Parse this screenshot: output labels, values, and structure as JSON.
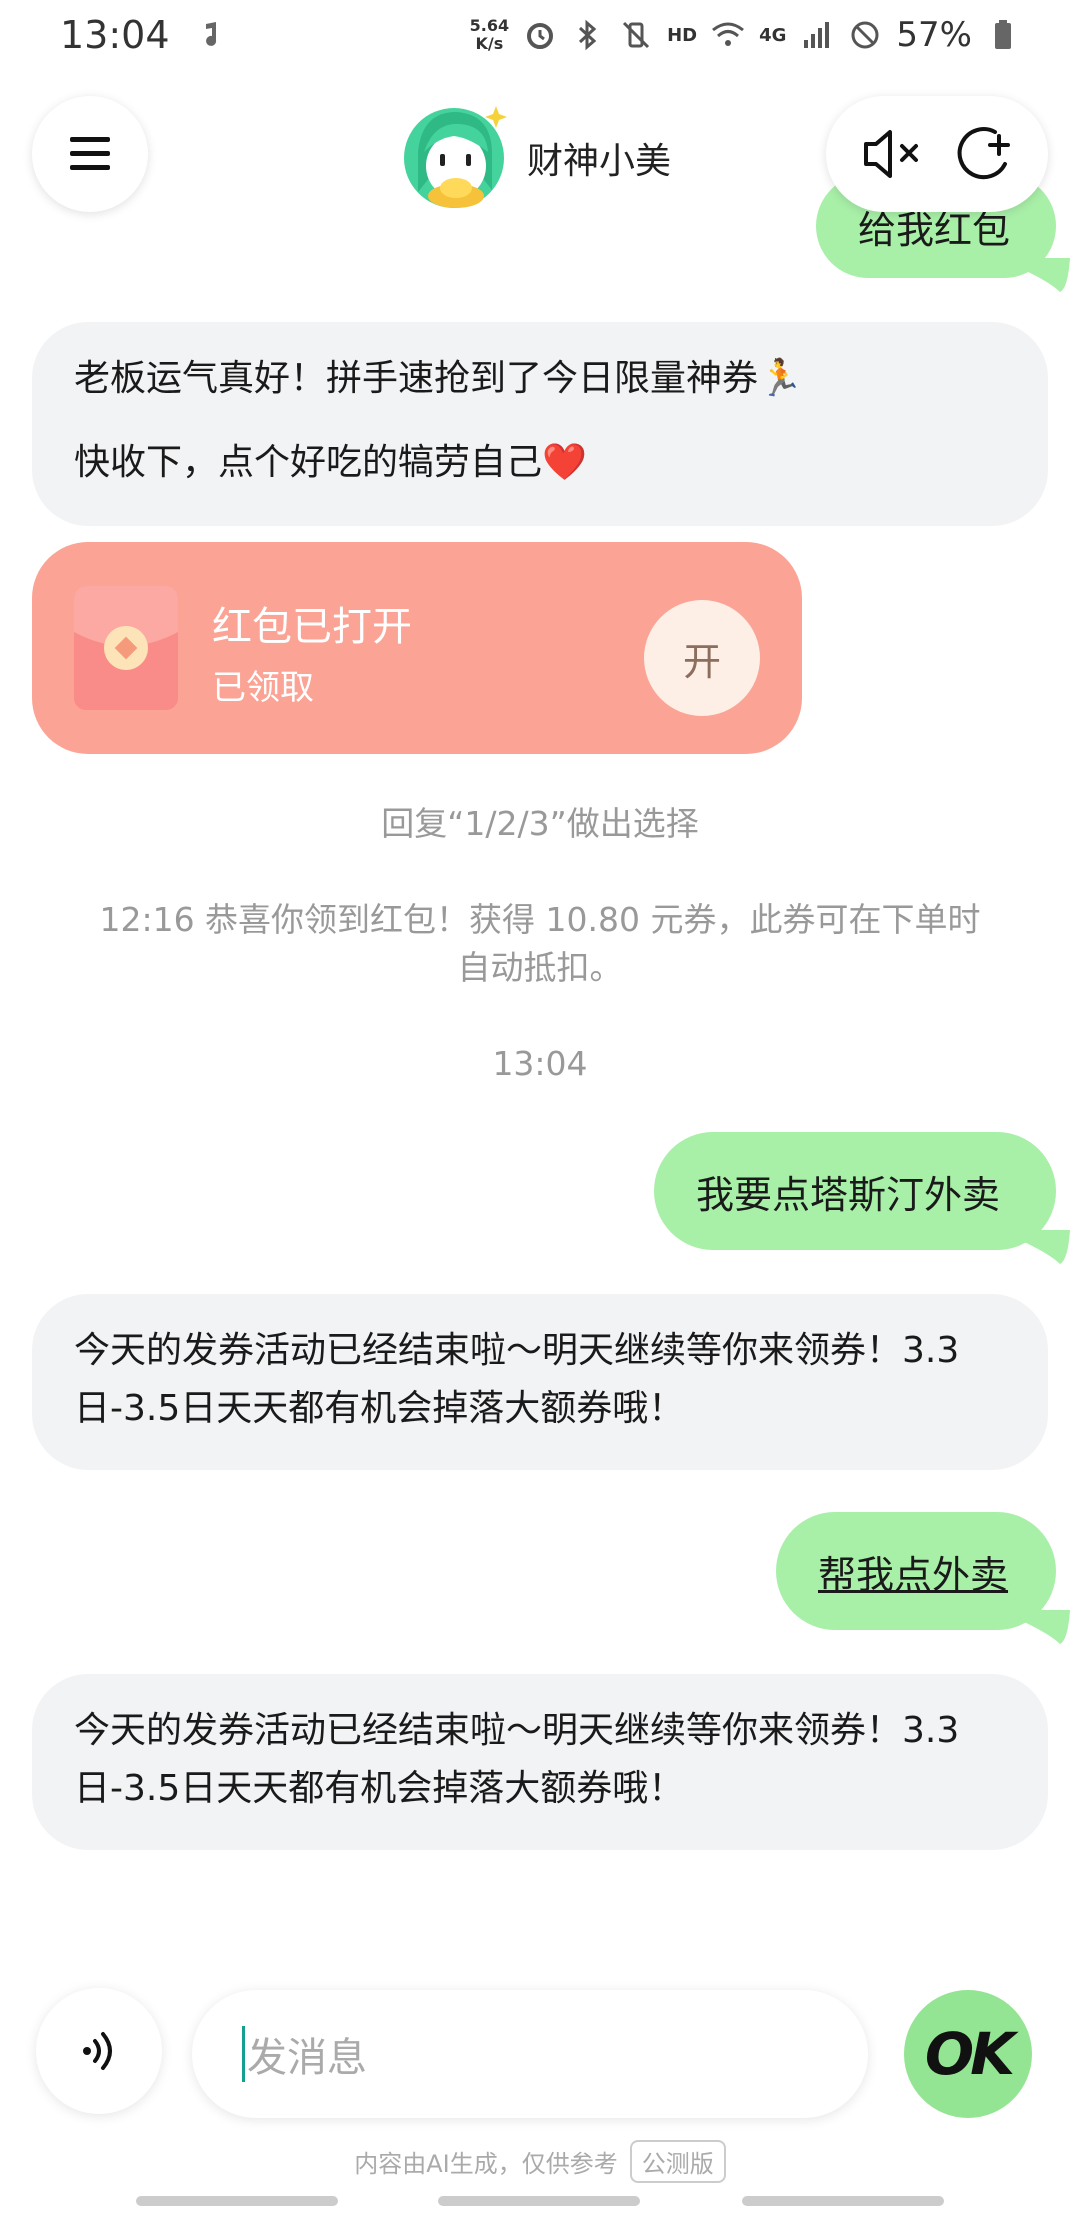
{
  "status_bar": {
    "time": "13:04",
    "speed_value": "5.64",
    "speed_unit": "K/s",
    "network": "4G",
    "hd": "HD",
    "battery": "57%"
  },
  "header": {
    "bot_name": "财神小美"
  },
  "messages": {
    "user_1": "给我红包",
    "bot_1_line1": "老板运气真好！拼手速抢到了今日限量神券🏃",
    "bot_1_line2": "快收下，点个好吃的犒劳自己❤️",
    "redpack_title": "红包已打开",
    "redpack_subtitle": "已领取",
    "redpack_open": "开",
    "reply_hint": "回复“1/2/3”做出选择",
    "system_notice": "12:16 恭喜你领到红包！获得 10.80 元券，此券可在下单时自动抵扣。",
    "timestamp": "13:04",
    "user_2": "我要点塔斯汀外卖",
    "bot_2": "今天的发券活动已经结束啦～明天继续等你来领券！3.3日-3.5日天天都有机会掉落大额券哦！",
    "user_3": "帮我点外卖",
    "bot_3": "今天的发券活动已经结束啦～明天继续等你来领券！3.3日-3.5日天天都有机会掉落大额券哦！"
  },
  "input": {
    "placeholder": "发消息",
    "ok_label": "OK"
  },
  "footer": {
    "disclaimer": "内容由AI生成，仅供参考",
    "badge": "公测版"
  },
  "colors": {
    "user_bubble": "#a8efa8",
    "bot_bubble": "#f2f3f5",
    "redpack": "#fba394",
    "ok_button": "#93e593"
  },
  "icons": [
    "menu-icon",
    "mute-icon",
    "new-chat-icon",
    "voice-icon",
    "ok-icon",
    "red-envelope-icon"
  ]
}
